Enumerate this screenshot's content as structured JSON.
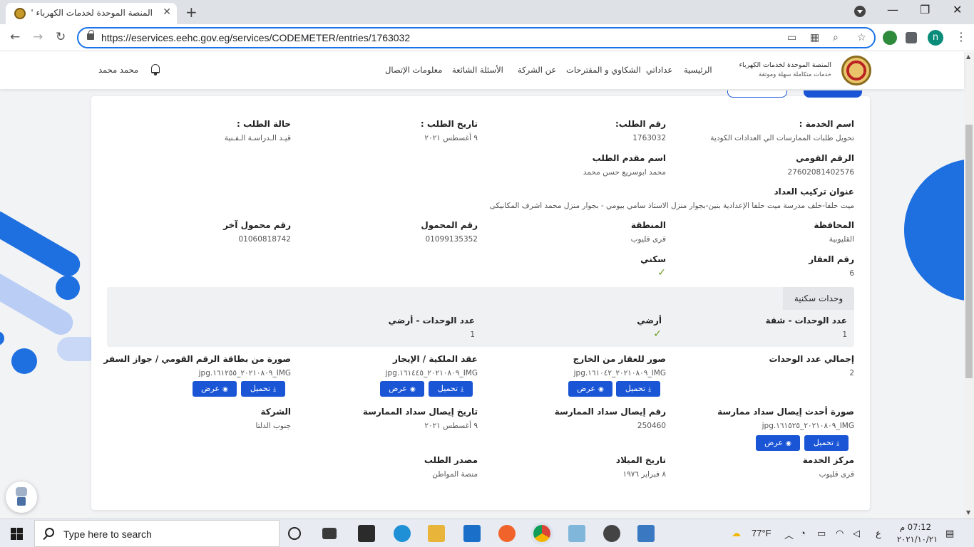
{
  "browser": {
    "tab_title": "المنصة الموحدة لخدمات الكهرباء 's",
    "url": "https://eservices.eehc.gov.eg/services/CODEMETER/entries/1763032",
    "profile_initial": "n"
  },
  "site": {
    "brand_line1": "المنصة الموحدة لخدمات الكهرباء",
    "brand_line2": "خدمات متكاملة سهلة وموثقة",
    "nav": [
      "الرئيسية",
      "عداداتي",
      "الشكاوي و المقترحات",
      "عن الشركة",
      "الأسئلة الشائعة",
      "معلومات الإتصال"
    ],
    "user_name": "محمد محمد"
  },
  "request": {
    "service_name_label": "اسم الخدمة :",
    "service_name_value": "تحويل طلبات الممارسات الي العدادات الكودية",
    "request_number_label": "رقم الطلب:",
    "request_number_value": "1763032",
    "request_date_label": "تاريخ الطلب :",
    "request_date_value": "٩ أغسطس ٢٠٢١",
    "request_status_label": "حالة الطلب :",
    "request_status_value": "قيـد الـدراسـة الـفـنية",
    "national_id_label": "الرقم القومي",
    "national_id_value": "27602081402576",
    "applicant_label": "اسم مقدم الطلب",
    "applicant_value": "محمد ابوسريع حسن محمد",
    "address_label": "عنوان تركيب العداد",
    "address_value": "ميت حلفا-خلف مدرسة ميت حلفا الإعدادية بنين-بجوار منزل الاستاذ سامي بيومي - بجوار منزل محمد اشرف المكانيكى",
    "governorate_label": "المحافظة",
    "governorate_value": "القليوبية",
    "region_label": "المنطقة",
    "region_value": "قرى قليوب",
    "mobile_label": "رقم المحمول",
    "mobile_value": "01099135352",
    "other_mobile_label": "رقم محمول آخر",
    "other_mobile_value": "01060818742",
    "property_number_label": "رقم العقار",
    "property_number_value": "6",
    "residential_label": "سكني",
    "residential_units_tab": "وحدات سكنية",
    "apartments_count_label": "عدد الوحدات - شقة",
    "apartments_count_value": "1",
    "ground_label": "أرضي",
    "ground_units_label": "عدد الوحدات - أرضي",
    "ground_units_value": "1",
    "total_units_label": "إجمالي عدد الوحدات",
    "total_units_value": "2",
    "outside_photo_label": "صور للعقار من الخارج",
    "outside_photo_value": "IMG_٢٠٢١٠٨٠٩_١٦١٠٤٢.jpg",
    "ownership_label": "عقد الملكية / الإيجار",
    "ownership_value": "IMG_٢٠٢١٠٨٠٩_١٦١٤٤٥.jpg",
    "id_copy_label": "صورة من بطاقة الرقم القومي / جواز السفر",
    "id_copy_value": "IMG_٢٠٢١٠٨٠٩_١٦١٢٥٥.jpg",
    "latest_receipt_label": "صورة أحدث إيصال سداد ممارسة",
    "latest_receipt_value": "IMG_٢٠٢١٠٨٠٩_١٦١٥٢٥.jpg",
    "receipt_number_label": "رقم إيصال سداد الممارسة",
    "receipt_number_value": "250460",
    "receipt_date_label": "تاريخ إيصال سداد الممارسة",
    "receipt_date_value": "٩ أغسطس ٢٠٢١",
    "company_label": "الشركة",
    "company_value": "جنوب الدلتا",
    "service_center_label": "مركز الخدمة",
    "service_center_value": "قرى قليوب",
    "birth_date_label": "تاريخ الميلاد",
    "birth_date_value": "٨ فبراير ١٩٧٦",
    "request_source_label": "مصدر الطلب",
    "request_source_value": "منصة المواطن"
  },
  "buttons": {
    "download": "تحميل",
    "view": "عرض"
  },
  "taskbar": {
    "search_placeholder": "Type here to search",
    "weather": "77°F",
    "lang": "ع",
    "time": "07:12 م",
    "date": "٢٠٢١/١٠/٢١"
  },
  "colors": {
    "accent": "#1a55d6",
    "deco_blue": "#1e6fe0",
    "check_green": "#6c9a1f"
  }
}
